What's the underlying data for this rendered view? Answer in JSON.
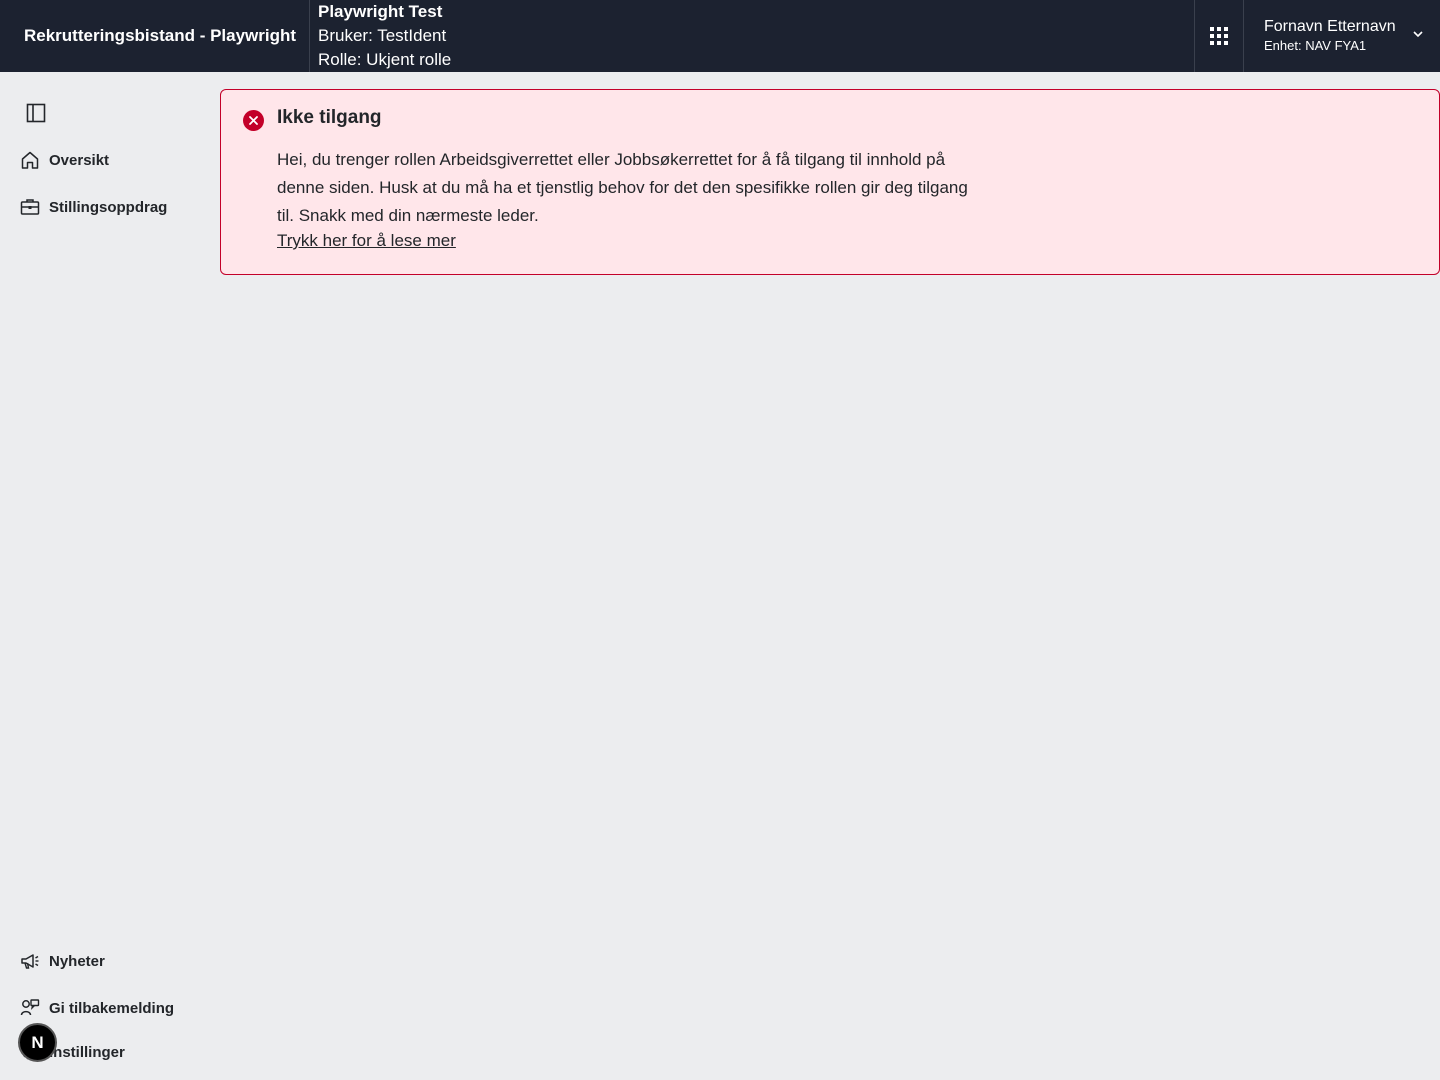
{
  "header": {
    "app_title": "Rekrutteringsbistand - Playwright",
    "user_name": "Playwright Test",
    "user_ident": "Bruker: TestIdent",
    "user_role": "Rolle: Ukjent rolle",
    "profile_name": "Fornavn Etternavn",
    "profile_unit": "Enhet: NAV FYA1",
    "apps_icon": "grid-icon"
  },
  "sidebar": {
    "top_items": [
      {
        "label": "Oversikt",
        "icon": "home-icon"
      },
      {
        "label": "Stillingsoppdrag",
        "icon": "briefcase-icon"
      }
    ],
    "bottom_items": [
      {
        "label": "Nyheter",
        "icon": "megaphone-icon"
      },
      {
        "label": "Gi tilbakemelding",
        "icon": "feedback-icon"
      },
      {
        "label": "Instillinger",
        "icon": "gear-icon"
      }
    ]
  },
  "alert": {
    "title": "Ikke tilgang",
    "body": "Hei, du trenger rollen Arbeidsgiverrettet eller Jobbsøkerrettet for å få tilgang til innhold på denne siden. Husk at du må ha et tjenstlig behov for det den spesifikke rollen gir deg tilgang til. Snakk med din nærmeste leder.",
    "link": "Trykk her for å lese mer"
  },
  "badge": {
    "label": "N"
  },
  "colors": {
    "header_bg": "#1c2230",
    "page_bg": "#ecedef",
    "alert_bg": "#ffe6ea",
    "alert_border": "#c30029",
    "error_icon": "#c30029"
  }
}
